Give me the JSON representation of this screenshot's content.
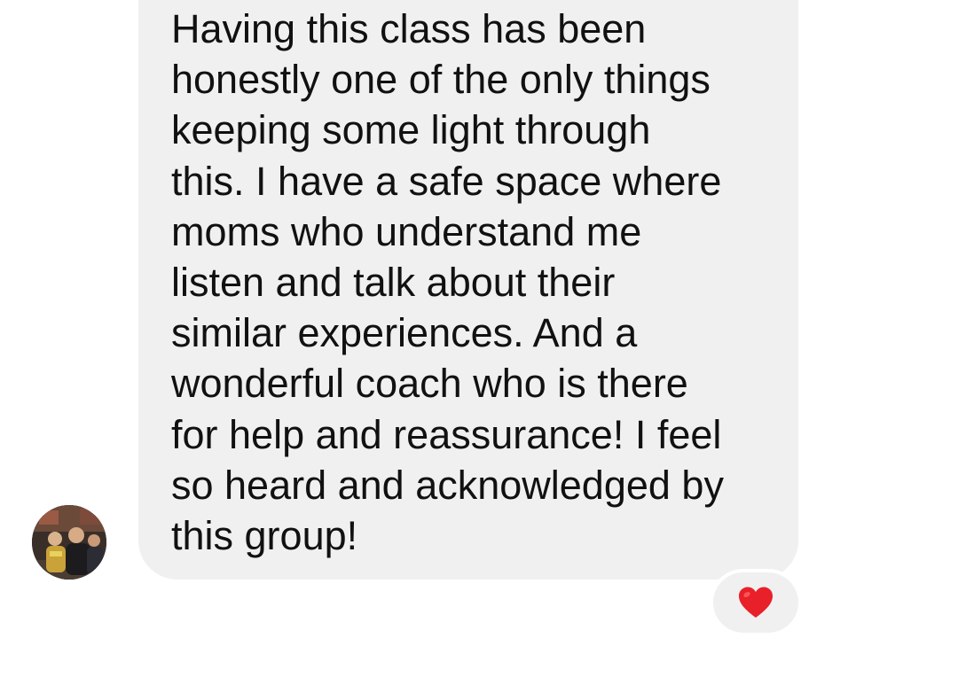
{
  "conversation": {
    "message": {
      "sender_avatar": "avatar-photo",
      "lines": [
        "Having this class has been",
        "honestly one of the only things",
        "keeping some light through",
        "this. I have a safe space where",
        "moms who understand me",
        "listen and talk about their",
        "similar experiences. And a",
        "wonderful coach who is there",
        "for help and reassurance! I feel",
        "so heard and acknowledged by",
        "this group!"
      ],
      "reaction": {
        "icon": "red-heart-icon",
        "color": "#e8202a"
      }
    }
  },
  "colors": {
    "bubble_background": "#f0f0f0",
    "text": "#111111",
    "page_background": "#ffffff"
  }
}
